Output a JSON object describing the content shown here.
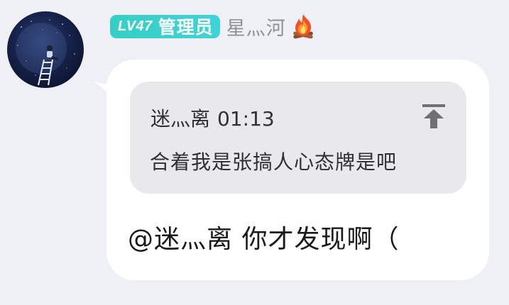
{
  "sender": {
    "level_label": "LV47",
    "role_label": "管理员",
    "nickname": "星灬河",
    "title_icon": "fire-icon",
    "avatar": "avatar-girl-on-crescent-moon"
  },
  "message": {
    "quote": {
      "author": "迷灬离",
      "time": "01:13",
      "text": "合着我是张搞人心态牌是吧",
      "jump_icon": "jump-to-top-arrow-icon"
    },
    "text": "@迷灬离 你才发现啊（"
  },
  "colors": {
    "background": "#eff0f5",
    "bubble": "#ffffff",
    "quote_card": "#e9e9ec",
    "level_badge": "#35cfc4",
    "nickname": "#8f8f96",
    "text": "#1a1a1c"
  }
}
